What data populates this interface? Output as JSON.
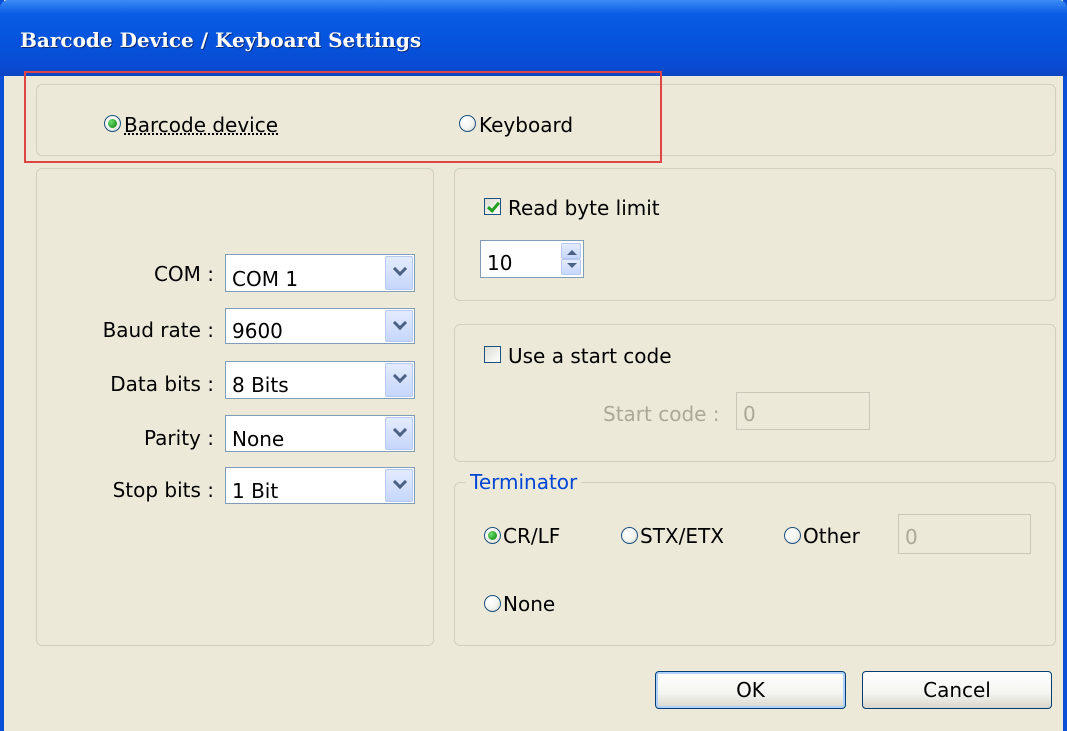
{
  "window": {
    "title": "Barcode Device / Keyboard Settings"
  },
  "device_type": {
    "selected": "Barcode device",
    "options": [
      {
        "label": "Barcode device",
        "checked": true
      },
      {
        "label": "Keyboard",
        "checked": false
      }
    ]
  },
  "serial": {
    "fields": [
      {
        "label": "COM :",
        "value": "COM 1"
      },
      {
        "label": "Baud rate :",
        "value": "9600"
      },
      {
        "label": "Data bits :",
        "value": "8 Bits"
      },
      {
        "label": "Parity :",
        "value": "None"
      },
      {
        "label": "Stop bits :",
        "value": "1 Bit"
      }
    ]
  },
  "read_limit": {
    "label": "Read byte limit",
    "checked": true,
    "value": "10"
  },
  "start_code": {
    "label": "Use a start code",
    "checked": false,
    "field_label": "Start code :",
    "value": "0"
  },
  "terminator": {
    "legend": "Terminator",
    "options": [
      {
        "label": "CR/LF",
        "checked": true
      },
      {
        "label": "STX/ETX",
        "checked": false
      },
      {
        "label": "Other",
        "checked": false
      },
      {
        "label": "None",
        "checked": false
      }
    ],
    "other_value": "0"
  },
  "buttons": {
    "ok": "OK",
    "cancel": "Cancel"
  },
  "colors": {
    "title_bar": "#0553dd",
    "dialog_bg": "#ece9d8",
    "highlight": "#e04545",
    "legend_text": "#0046d5"
  }
}
